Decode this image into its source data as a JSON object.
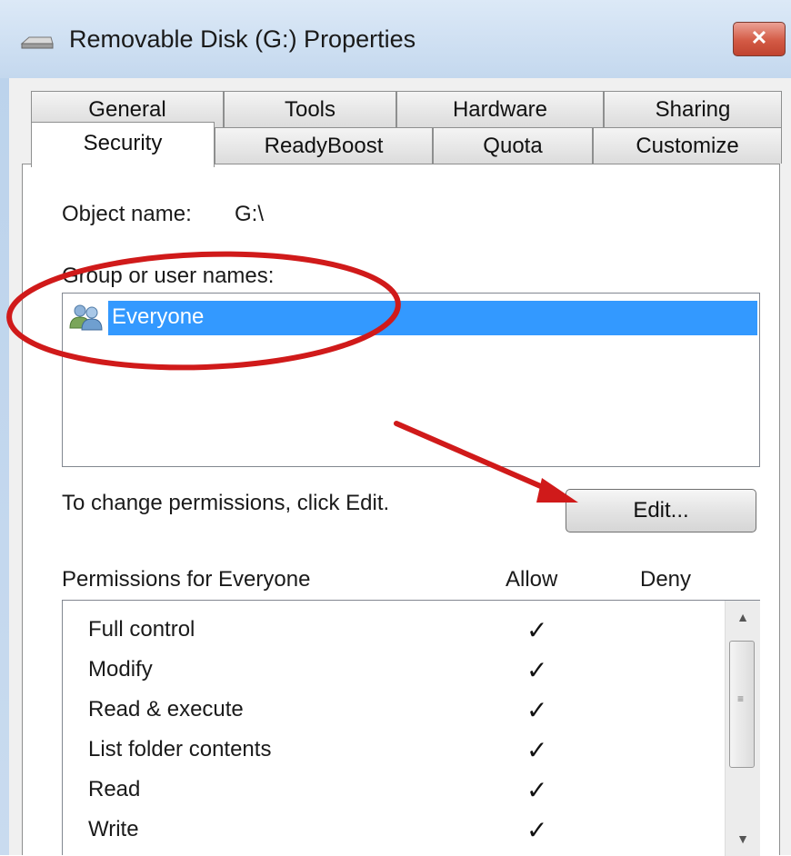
{
  "window": {
    "title": "Removable Disk (G:) Properties",
    "close_glyph": "✕"
  },
  "tabs_row1": [
    "General",
    "Tools",
    "Hardware",
    "Sharing"
  ],
  "tabs_row2": [
    "Security",
    "ReadyBoost",
    "Quota",
    "Customize"
  ],
  "active_tab": "Security",
  "security": {
    "object_name_label": "Object name:",
    "object_name_value": "G:\\",
    "group_label": "Group or user names:",
    "groups": [
      {
        "name": "Everyone",
        "icon": "users-group-icon",
        "selected": true
      }
    ],
    "change_hint": "To change permissions, click Edit.",
    "edit_button": "Edit...",
    "permissions_label": "Permissions for Everyone",
    "allow_header": "Allow",
    "deny_header": "Deny",
    "permissions": [
      {
        "name": "Full control",
        "allow": "✓",
        "deny": ""
      },
      {
        "name": "Modify",
        "allow": "✓",
        "deny": ""
      },
      {
        "name": "Read & execute",
        "allow": "✓",
        "deny": ""
      },
      {
        "name": "List folder contents",
        "allow": "✓",
        "deny": ""
      },
      {
        "name": "Read",
        "allow": "✓",
        "deny": ""
      },
      {
        "name": "Write",
        "allow": "✓",
        "deny": ""
      }
    ]
  },
  "scrollbar": {
    "up_glyph": "▲",
    "down_glyph": "▼",
    "grip_glyph": "≡"
  },
  "colors": {
    "selection": "#3399ff",
    "annotation_red": "#d01a1a"
  }
}
